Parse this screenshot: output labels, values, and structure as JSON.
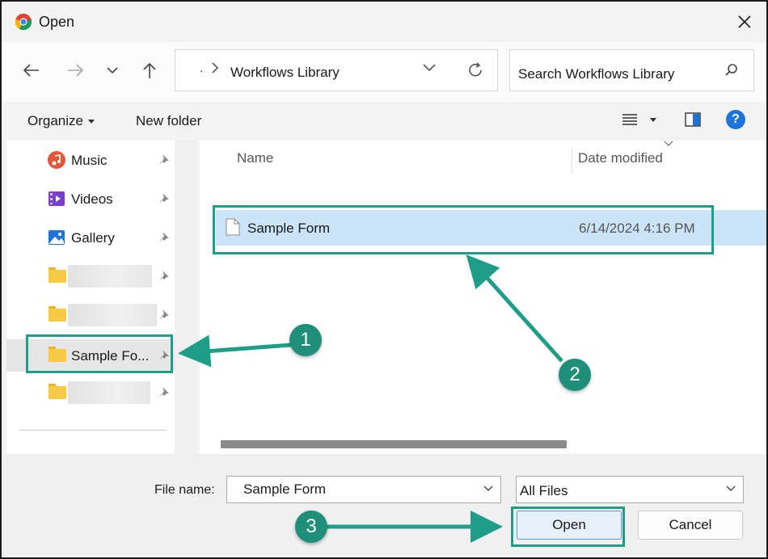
{
  "window": {
    "title": "Open",
    "close_icon": "close-icon",
    "app_icon": "chrome-icon"
  },
  "address": {
    "prefix": ".",
    "path": "Workflows Library",
    "nav_icons": [
      "back-arrow-icon",
      "forward-arrow-icon",
      "recent-chevron-icon",
      "up-arrow-icon",
      "refresh-icon"
    ]
  },
  "search": {
    "placeholder": "Search Workflows Library"
  },
  "toolbar": {
    "organize_label": "Organize",
    "new_folder_label": "New folder",
    "help_label": "?"
  },
  "sidebar": {
    "items": [
      {
        "label": "Music",
        "icon": "music-icon"
      },
      {
        "label": "Videos",
        "icon": "videos-icon"
      },
      {
        "label": "Gallery",
        "icon": "gallery-icon"
      },
      {
        "label": "",
        "icon": "folder-icon"
      },
      {
        "label": "",
        "icon": "folder-icon"
      },
      {
        "label": "Sample Fo...",
        "icon": "folder-icon"
      },
      {
        "label": "",
        "icon": "folder-icon"
      }
    ]
  },
  "files": {
    "columns": [
      "Name",
      "Date modified"
    ],
    "rows": [
      {
        "name": "Sample Form",
        "date": "6/14/2024 4:16 PM"
      }
    ]
  },
  "bottom": {
    "file_name_label": "File name:",
    "file_name_value": "Sample Form",
    "file_type_value": "All Files",
    "open_label": "Open",
    "cancel_label": "Cancel"
  },
  "annotations": {
    "step1": "1",
    "step2": "2",
    "step3": "3",
    "color": "#1e9e88"
  }
}
